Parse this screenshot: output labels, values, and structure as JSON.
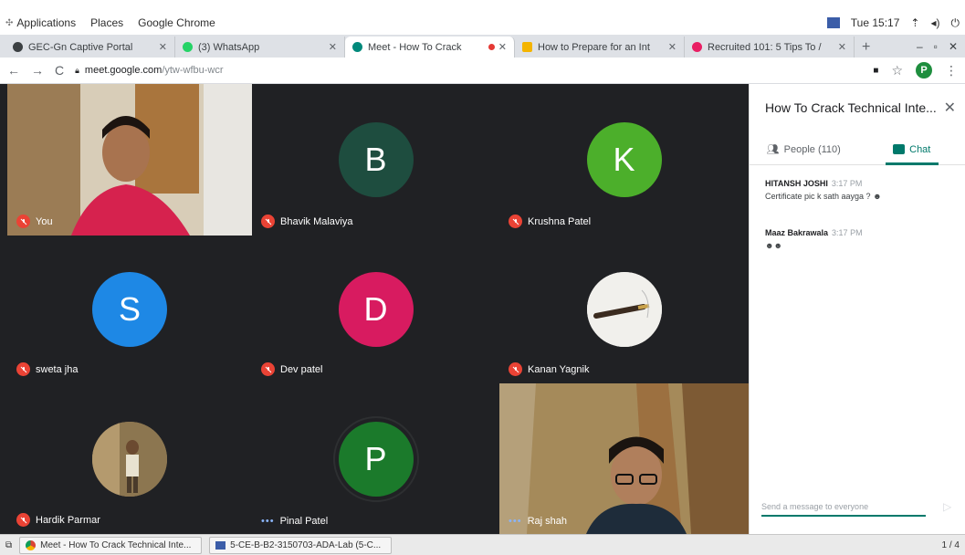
{
  "gnome": {
    "menus": [
      "Applications",
      "Places",
      "Google Chrome"
    ],
    "clock": "Tue 15:17"
  },
  "tabs": [
    {
      "title": "GEC-Gn Captive Portal",
      "favicon_color": "#3c4043"
    },
    {
      "title": "(3) WhatsApp",
      "favicon_color": "#25d366"
    },
    {
      "title": "Meet - How To Crack",
      "favicon_color": "#00897b",
      "active": true
    },
    {
      "title": "How to Prepare for an Int",
      "favicon_color": "#f4b400"
    },
    {
      "title": "Recruited 101: 5 Tips To /",
      "favicon_color": "#e91e63"
    }
  ],
  "toolbar": {
    "url_host": "meet.google.com",
    "url_path": "/ytw-wfbu-wcr",
    "profile_initial": "P"
  },
  "participants": [
    {
      "name": "You",
      "type": "video",
      "muted": true
    },
    {
      "name": "Bhavik Malaviya",
      "initial": "B",
      "color": "#1e4d3f",
      "muted": true
    },
    {
      "name": "Krushna Patel",
      "initial": "K",
      "color": "#4caf2b",
      "muted": true
    },
    {
      "name": "sweta jha",
      "initial": "S",
      "color": "#1e88e5",
      "muted": true
    },
    {
      "name": "Dev patel",
      "initial": "D",
      "color": "#d81b60",
      "muted": true
    },
    {
      "name": "Kanan Yagnik",
      "type": "photo",
      "muted": true
    },
    {
      "name": "Hardik Parmar",
      "type": "photo",
      "muted": true
    },
    {
      "name": "Pinal Patel",
      "initial": "P",
      "color": "#1b7a2b",
      "muted": false
    },
    {
      "name": "Raj shah",
      "type": "video",
      "muted": false
    }
  ],
  "panel": {
    "title": "How To Crack Technical Inte...",
    "people_label": "People (110)",
    "chat_label": "Chat",
    "messages": [
      {
        "sender": "HITANSH JOSHI",
        "time": "3:17 PM",
        "text": "Certificate pic k sath aayga ?"
      },
      {
        "sender": "Maaz Bakrawala",
        "time": "3:17 PM",
        "text": ""
      }
    ],
    "composer_placeholder": "Send a message to everyone"
  },
  "taskbar": {
    "items": [
      "Meet - How To Crack Technical Inte...",
      "5-CE-B-B2-3150703-ADA-Lab (5-C..."
    ],
    "pager": "1 / 4"
  }
}
